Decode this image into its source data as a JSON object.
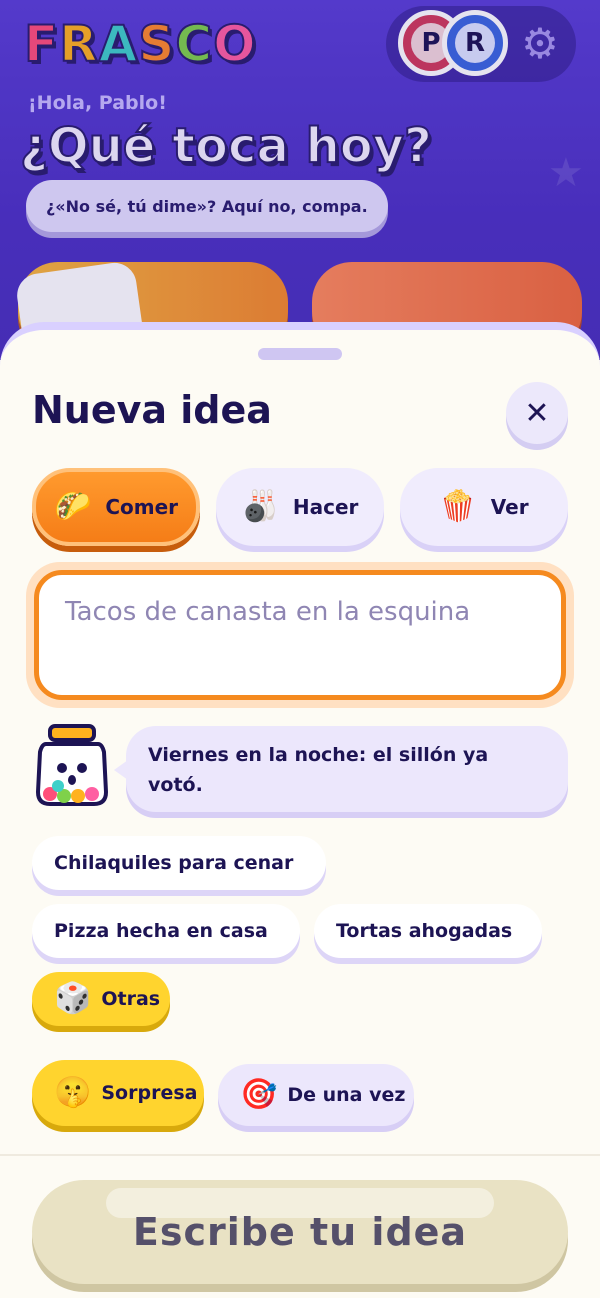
{
  "background": {
    "logo": [
      "F",
      "R",
      "A",
      "S",
      "C",
      "O"
    ],
    "logo_colors": [
      "#ff4f7a",
      "#ffb21e",
      "#3fd0c9",
      "#ff8a2a",
      "#7fd14a",
      "#ff5fa2"
    ],
    "avatars": [
      "P",
      "R"
    ],
    "greeting": "¡Hola, Pablo!",
    "headline": "¿Qué toca hoy?",
    "subline": "¿«No sé, tú dime»? Aquí no, compa."
  },
  "sheet": {
    "title": "Nueva idea",
    "close_icon": "close-icon",
    "categories": [
      {
        "label": "Comer",
        "icon": "taco-icon",
        "active": true
      },
      {
        "label": "Hacer",
        "icon": "bowling-icon",
        "active": false
      },
      {
        "label": "Ver",
        "icon": "popcorn-icon",
        "active": false
      }
    ],
    "input": {
      "placeholder": "Tacos de canasta en la esquina",
      "value": ""
    },
    "mascot_message": "Viernes en la noche: el sillón ya votó.",
    "suggestions": [
      "Chilaquiles para cenar",
      "Pizza hecha en casa",
      "Tortas ahogadas"
    ],
    "more_label": "Otras",
    "surprise_label": "Sorpresa",
    "once_label": "De una vez",
    "cta_label": "Escribe tu idea"
  },
  "colors": {
    "accent_orange": "#f57d17",
    "ink": "#1d1454",
    "header_purple": "#5a3fd6",
    "yellow": "#ffd42e"
  }
}
